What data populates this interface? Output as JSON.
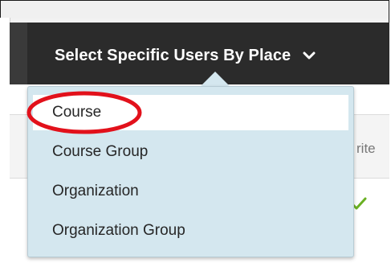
{
  "toolbar": {
    "dropdown_label": "Select Specific Users By Place",
    "chevron_icon": "chevron-down-icon"
  },
  "table": {
    "partial_header": "rite",
    "check_icon": "check-icon",
    "check_color": "#6ab023"
  },
  "menu": {
    "items": [
      {
        "label": "Course",
        "selected": true
      },
      {
        "label": "Course Group",
        "selected": false
      },
      {
        "label": "Organization",
        "selected": false
      },
      {
        "label": "Organization Group",
        "selected": false
      }
    ]
  },
  "annotation": {
    "highlight_color": "#e2111b",
    "highlight_target": "Course"
  }
}
